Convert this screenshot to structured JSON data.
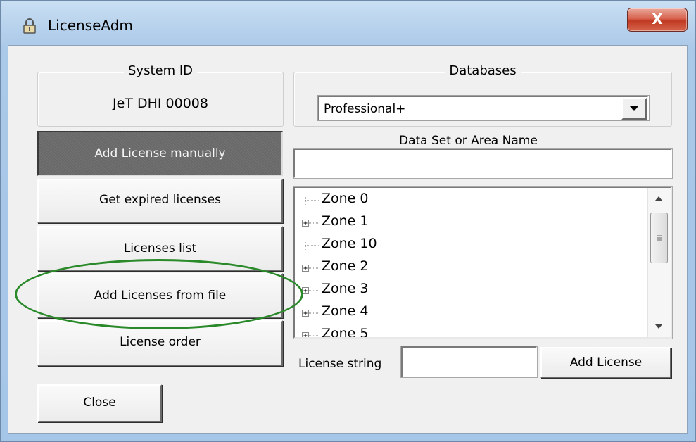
{
  "window": {
    "title": "LicenseAdm",
    "close_glyph": "X",
    "icon": "padlock-icon"
  },
  "system_id": {
    "legend": "System ID",
    "value": "JeT DHI 00008"
  },
  "databases": {
    "legend": "Databases",
    "selected": "Professional+"
  },
  "data_set": {
    "label": "Data Set or Area Name",
    "value": ""
  },
  "buttons": {
    "add_manual": "Add License manually",
    "get_expired": "Get expired licenses",
    "licenses_list": "Licenses list",
    "add_from_file": "Add Licenses from file",
    "license_order": "License order",
    "close": "Close",
    "add_license": "Add License"
  },
  "tree": {
    "items": [
      {
        "label": "Zone 0",
        "expandable": false
      },
      {
        "label": "Zone 1",
        "expandable": true
      },
      {
        "label": "Zone 10",
        "expandable": false
      },
      {
        "label": "Zone 2",
        "expandable": true
      },
      {
        "label": "Zone 3",
        "expandable": true
      },
      {
        "label": "Zone 4",
        "expandable": true
      },
      {
        "label": "Zone 5",
        "expandable": true
      }
    ]
  },
  "license_string": {
    "label": "License string",
    "value": ""
  },
  "colors": {
    "highlight": "#2a8a2a",
    "active_button": "#696969",
    "close_red": "#c13a23"
  }
}
